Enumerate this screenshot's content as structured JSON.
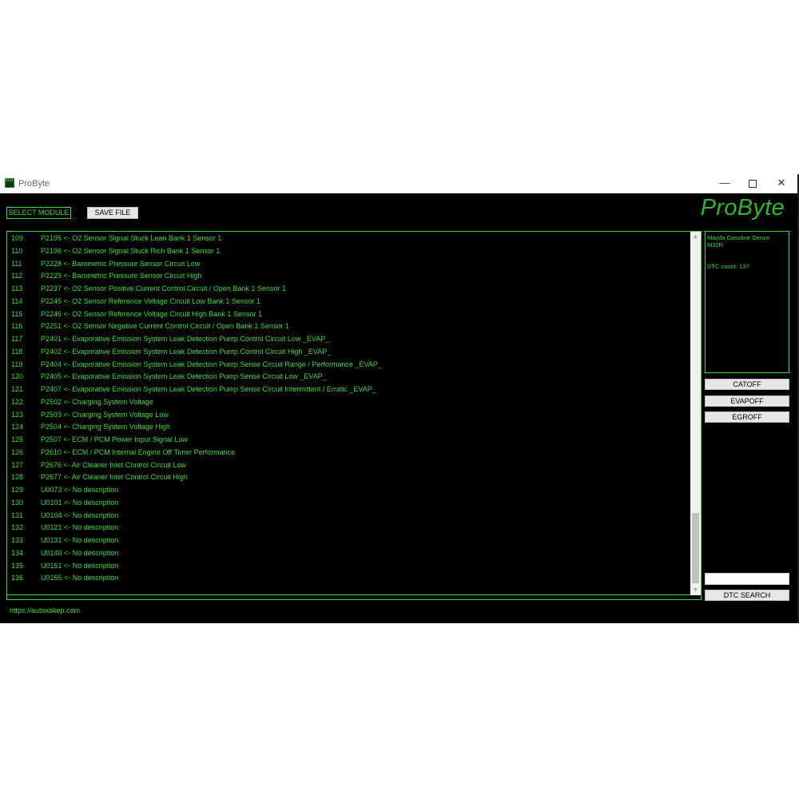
{
  "window": {
    "title": "ProByte",
    "icon_text": "ECU"
  },
  "toolbar": {
    "select_module_label": "SELECT MODULE",
    "save_file_label": "SAVE FILE"
  },
  "brand": "ProByte",
  "dtc_list": [
    {
      "num": "109",
      "text": "P2195 <- O2 Sensor Signal Stuck Lean Bank 1 Sensor 1"
    },
    {
      "num": "110",
      "text": "P2196 <- O2 Sensor Signal Stuck Rich Bank 1 Sensor 1"
    },
    {
      "num": "111",
      "text": "P2228 <- Barometric Pressure Sensor Circuit Low"
    },
    {
      "num": "112",
      "text": "P2229 <- Barometric Pressure Sensor Circuit High"
    },
    {
      "num": "113",
      "text": "P2237 <- O2 Sensor Positive Current Control Circuit / Open Bank 1 Sensor 1"
    },
    {
      "num": "114",
      "text": "P2245 <- O2 Sensor Reference Voltage Circuit Low Bank 1 Sensor 1"
    },
    {
      "num": "115",
      "text": "P2246 <- O2 Sensor Reference Voltage Circuit High  Bank 1 Sensor 1"
    },
    {
      "num": "116",
      "text": "P2251 <- O2 Sensor Negative Current Control Circuit / Open Bank 1 Sensor 1"
    },
    {
      "num": "117",
      "text": "P2401 <- Evaporative Emission System Leak Detection Pump Control Circuit Low _EVAP_"
    },
    {
      "num": "118",
      "text": "P2402 <- Evaporative Emission System Leak Detection Pump Control Circuit High _EVAP_"
    },
    {
      "num": "119",
      "text": "P2404 <- Evaporative Emission System Leak Detection Pump Sense Circuit Range / Performance _EVAP_"
    },
    {
      "num": "120",
      "text": "P2405 <- Evaporative Emission System Leak Detection Pump Sense Circuit Low _EVAP_"
    },
    {
      "num": "121",
      "text": "P2407 <- Evaporative Emission System Leak Detection Pump Sense Circuit Intermittent / Erratic _EVAP_"
    },
    {
      "num": "122",
      "text": "P2502 <- Charging System Voltage"
    },
    {
      "num": "123",
      "text": "P2503 <- Charging System Voltage Low"
    },
    {
      "num": "124",
      "text": "P2504 <- Charging System Voltage High"
    },
    {
      "num": "125",
      "text": "P2507 <- ECM / PCM Power Input Signal Low"
    },
    {
      "num": "126",
      "text": "P2610 <- ECM / PCM Internal Engine Off Timer Performance"
    },
    {
      "num": "127",
      "text": "P2676 <- Air Cleaner Inlet Control Circuit Low"
    },
    {
      "num": "128",
      "text": "P2677 <- Air Cleaner Inlet Control Circuit High"
    },
    {
      "num": "129",
      "text": "U0073 <- No description"
    },
    {
      "num": "130",
      "text": "U0101 <- No description"
    },
    {
      "num": "131",
      "text": "U0104 <- No description"
    },
    {
      "num": "132",
      "text": "U0121 <- No description"
    },
    {
      "num": "133",
      "text": "U0131 <- No description"
    },
    {
      "num": "134",
      "text": "U0140 <- No description"
    },
    {
      "num": "135",
      "text": "U0151 <- No description"
    },
    {
      "num": "136",
      "text": "U0155 <- No description"
    }
  ],
  "info": {
    "line1": "Mazda Gasoline Denso",
    "line2": "M32R",
    "dtc_count": "DTC count: 137"
  },
  "side_buttons": {
    "catoff": "CATOFF",
    "evapoff": "EVAPOFF",
    "egroff": "EGROFF"
  },
  "search": {
    "value": "",
    "button_label": "DTC SEARCH"
  },
  "status_url": "https://autoxakep.com",
  "colors": {
    "accent_green": "#3cdc3c",
    "brand_green": "#2fb52f",
    "background": "#000000"
  },
  "icons": {
    "minimize": "minimize-icon",
    "maximize": "maximize-icon",
    "close": "close-icon"
  }
}
